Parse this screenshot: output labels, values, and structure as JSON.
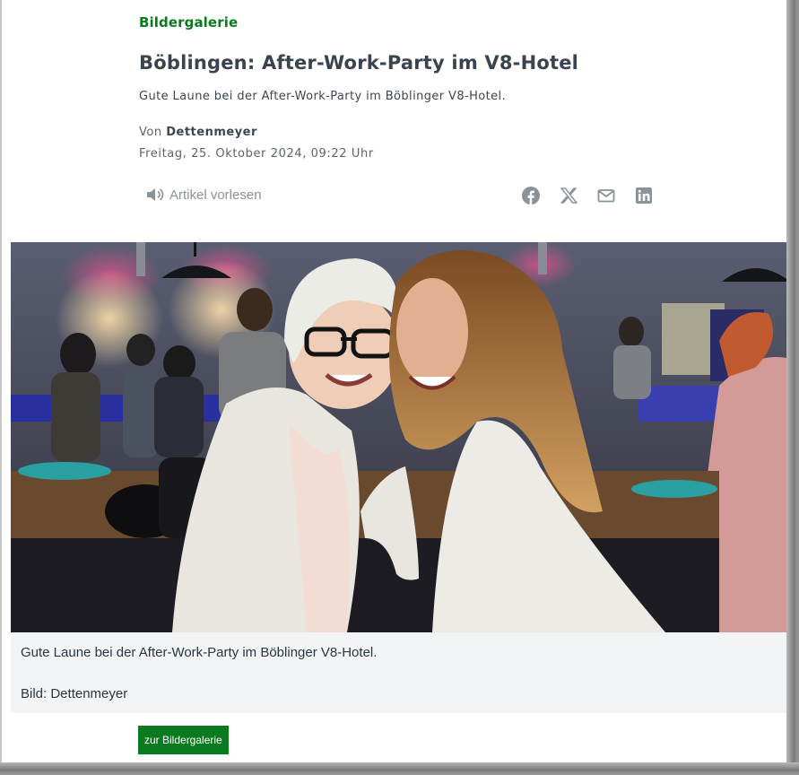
{
  "article": {
    "kicker": "Bildergalerie",
    "headline": "Böblingen: After-Work-Party im V8-Hotel",
    "teaser": "Gute Laune bei der After-Work-Party im Böblinger V8-Hotel.",
    "byline_prefix": "Von",
    "author": "Dettenmeyer",
    "date": "Freitag, 25. Oktober 2024, 09:22 Uhr"
  },
  "toolbar": {
    "read_aloud_label": "Artikel vorlesen",
    "read_aloud_icon": "speaker-icon",
    "share_icons": [
      "facebook-icon",
      "x-icon",
      "mail-icon",
      "linkedin-icon"
    ]
  },
  "image": {
    "caption": "Gute Laune bei der After-Work-Party im Böblinger V8-Hotel.",
    "credit": "Bild: Dettenmeyer"
  },
  "gallery_button": {
    "label": "zur Bildergalerie"
  },
  "colors": {
    "accent_green": "#0a7a1e",
    "headline": "#3a4450",
    "icon_gray": "#8a929a",
    "caption_bg": "#f2f4f5"
  }
}
